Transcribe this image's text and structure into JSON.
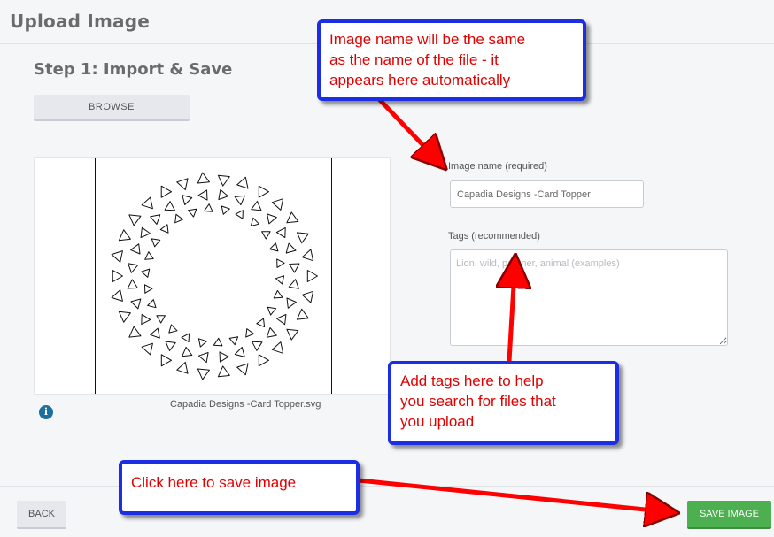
{
  "header": {
    "title": "Upload Image"
  },
  "step": {
    "title": "Step 1: Import & Save"
  },
  "browse": {
    "label": "BROWSE"
  },
  "preview": {
    "file_name": "Capadia Designs -Card Topper.svg",
    "info_icon": "info-icon"
  },
  "form": {
    "name_label": "Image name (required)",
    "name_value": "Capadia Designs -Card Topper",
    "tags_label": "Tags (recommended)",
    "tags_placeholder": "Lion, wild, panther, animal (examples)"
  },
  "footer": {
    "back_label": "BACK",
    "save_label": "SAVE IMAGE"
  },
  "callouts": {
    "image_name": "Image name will be the same\nas the name of the file - it\nappears here automatically",
    "tags": "Add tags here to help\nyou search for files that\nyou upload",
    "save": "Click here to save image"
  },
  "colors": {
    "accent_save": "#4caf50",
    "callout_border": "#1b2ee6",
    "callout_text": "#e00000",
    "arrow": "#ff0000",
    "info_icon": "#1d6f9e"
  }
}
